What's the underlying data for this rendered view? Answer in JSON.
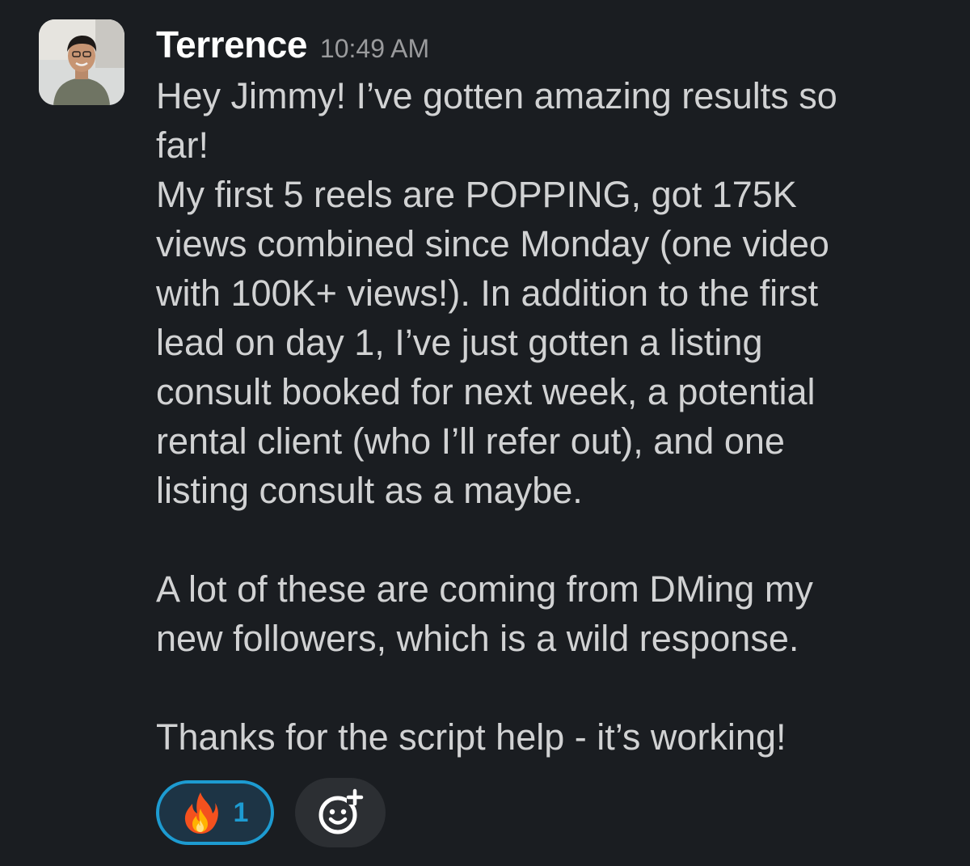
{
  "message": {
    "author": "Terrence",
    "timestamp": "10:49 AM",
    "lines": [
      "Hey Jimmy! I’ve gotten amazing results so",
      "far!",
      "My first 5 reels are POPPING, got 175K",
      "views combined since Monday (one video",
      "with 100K+ views!). In addition to the first",
      "lead on day 1, I’ve just gotten a listing",
      "consult booked for next week, a potential",
      "rental client (who I’ll refer out), and one",
      "listing consult as a maybe."
    ],
    "paragraph2_lines": [
      "A lot of these are coming from DMing my",
      "new followers, which is a wild response."
    ],
    "paragraph3_lines": [
      "Thanks for the script help - it’s working!"
    ]
  },
  "reactions": [
    {
      "emoji": "fire-icon",
      "count": "1"
    }
  ],
  "add_reaction_icon": "add-emoji-icon",
  "colors": {
    "background": "#1a1d21",
    "text": "#d1d2d3",
    "author": "#ffffff",
    "timestamp": "#9a9b9d",
    "reaction_accent": "#1d9bd1"
  }
}
